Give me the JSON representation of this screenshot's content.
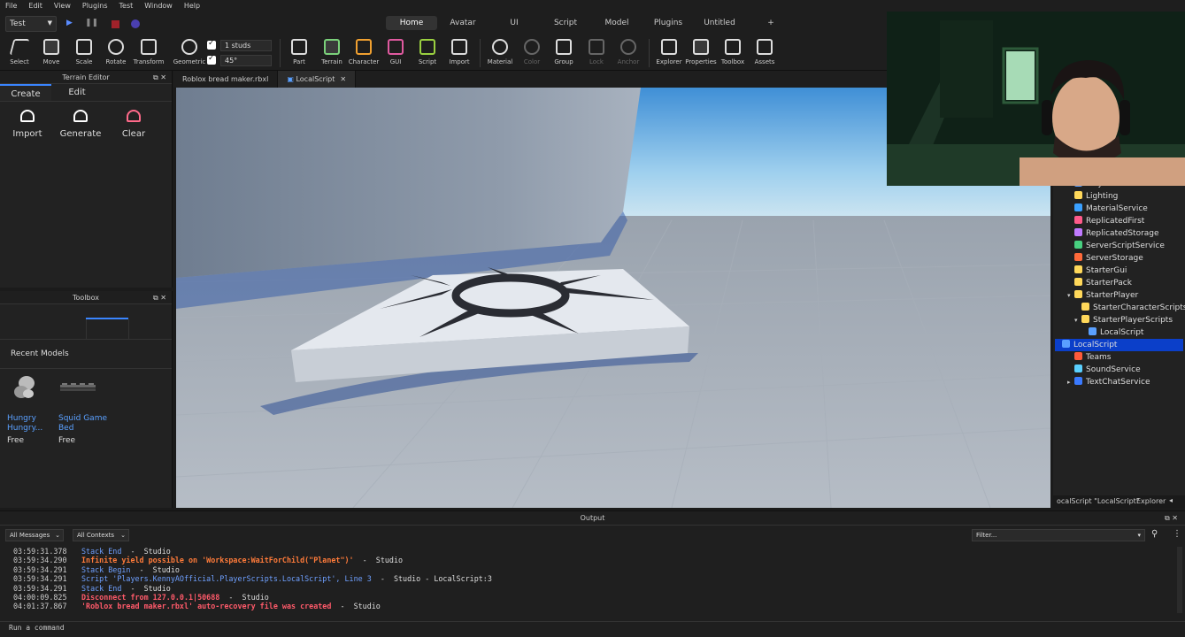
{
  "menu": [
    "File",
    "Edit",
    "View",
    "Plugins",
    "Test",
    "Window",
    "Help"
  ],
  "place_select": "Test",
  "ribbon_tabs": [
    "Home",
    "Avatar",
    "UI",
    "Script",
    "Model",
    "Plugins",
    "Untitled",
    "+"
  ],
  "tools": {
    "select": "Select",
    "move": "Move",
    "scale": "Scale",
    "rotate": "Rotate",
    "transform": "Transform",
    "geometric": "Geometric",
    "part": "Part",
    "terrain": "Terrain",
    "character": "Character",
    "gui": "GUI",
    "script": "Script",
    "import": "Import",
    "material": "Material",
    "color": "Color",
    "group": "Group",
    "lock": "Lock",
    "anchor": "Anchor",
    "explorer": "Explorer",
    "properties": "Properties",
    "toolbox": "Toolbox",
    "assets": "Assets"
  },
  "snap": {
    "move": "1 studs",
    "rotate": "45°"
  },
  "terrain_editor": {
    "title": "Terrain Editor",
    "tabs": [
      "Create",
      "Edit"
    ],
    "buttons": [
      "Import",
      "Generate",
      "Clear"
    ]
  },
  "toolbox": {
    "title": "Toolbox",
    "section": "Recent Models",
    "models": [
      {
        "name1": "Hungry",
        "name2": "Hungry...",
        "price": "Free"
      },
      {
        "name1": "Squid Game",
        "name2": "Bed",
        "price": "Free"
      }
    ]
  },
  "doc_tabs": [
    "Roblox bread maker.rbxl",
    "LocalScript"
  ],
  "explorer": {
    "items": [
      {
        "label": "Players",
        "indent": 0
      },
      {
        "label": "Lighting",
        "indent": 0
      },
      {
        "label": "MaterialService",
        "indent": 0
      },
      {
        "label": "ReplicatedFirst",
        "indent": 0
      },
      {
        "label": "ReplicatedStorage",
        "indent": 0
      },
      {
        "label": "ServerScriptService",
        "indent": 0
      },
      {
        "label": "ServerStorage",
        "indent": 0
      },
      {
        "label": "StarterGui",
        "indent": 0
      },
      {
        "label": "StarterPack",
        "indent": 0
      },
      {
        "label": "StarterPlayer",
        "indent": 0
      },
      {
        "label": "StarterCharacterScripts",
        "indent": 1
      },
      {
        "label": "StarterPlayerScripts",
        "indent": 1
      },
      {
        "label": "LocalScript",
        "indent": 2
      },
      {
        "label": "LocalScript",
        "indent": 2
      },
      {
        "label": "Teams",
        "indent": 0
      },
      {
        "label": "SoundService",
        "indent": 0
      },
      {
        "label": "TextChatService",
        "indent": 0
      }
    ],
    "footer_left": "ocalScript \"LocalScript\"",
    "footer_right": "Explorer"
  },
  "output": {
    "title": "Output",
    "filter1": "All Messages",
    "filter2": "All Contexts",
    "search_placeholder": "Filter...",
    "lines": [
      {
        "ts": "03:59:31.378",
        "parts": [
          {
            "t": "Stack End",
            "c": "b"
          },
          {
            "t": "  -  Studio",
            "c": "n"
          }
        ]
      },
      {
        "ts": "03:59:34.290",
        "parts": [
          {
            "t": "Infinite yield possible on 'Workspace:WaitForChild(\"Planet\")'",
            "c": "o"
          },
          {
            "t": "  -  Studio",
            "c": "n"
          }
        ]
      },
      {
        "ts": "03:59:34.291",
        "parts": [
          {
            "t": "Stack Begin",
            "c": "b"
          },
          {
            "t": "  -  Studio",
            "c": "n"
          }
        ]
      },
      {
        "ts": "03:59:34.291",
        "parts": [
          {
            "t": "Script 'Players.KennyAOfficial.PlayerScripts.LocalScript', Line 3",
            "c": "b"
          },
          {
            "t": "  -  Studio - LocalScript:3",
            "c": "n"
          }
        ]
      },
      {
        "ts": "03:59:34.291",
        "parts": [
          {
            "t": "Stack End",
            "c": "b"
          },
          {
            "t": "  -  Studio",
            "c": "n"
          }
        ]
      },
      {
        "ts": "04:00:09.825",
        "parts": [
          {
            "t": "Disconnect from 127.0.0.1|50688",
            "c": "r"
          },
          {
            "t": "  -  Studio",
            "c": "n"
          }
        ]
      },
      {
        "ts": "04:01:37.867",
        "parts": [
          {
            "t": "'Roblox bread maker.rbxl' auto-recovery file was created",
            "c": "r"
          },
          {
            "t": "  -  Studio",
            "c": "n"
          }
        ]
      }
    ],
    "command_placeholder": "Run a command"
  }
}
